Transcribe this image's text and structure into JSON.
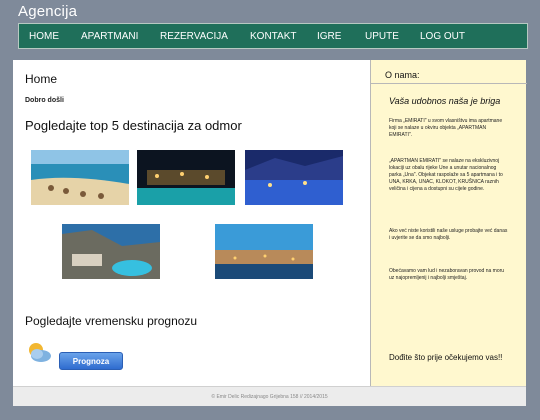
{
  "header": {
    "brand": "Agencija"
  },
  "nav": [
    {
      "label": "HOME"
    },
    {
      "label": "APARTMANI"
    },
    {
      "label": "REZERVACIJA"
    },
    {
      "label": "KONTAKT"
    },
    {
      "label": "IGRE"
    },
    {
      "label": "UPUTE"
    },
    {
      "label": "LOG OUT"
    }
  ],
  "main": {
    "title": "Home",
    "welcome": "Dobro došli",
    "destinations_title": "Pogledajte top 5 destinacija za odmor",
    "weather_title": "Pogledajte vremensku prognozu",
    "forecast_button": "Prognoza"
  },
  "sidebar": {
    "header": "O nama:",
    "slogan": "Vaša udobnos naša je briga",
    "paragraphs": [
      "Firma „EMIRATI\" u svom vlasništvu ima apartmane koji se nalaze u okviru objekta „APARTMAN EMIRATI\".",
      "„APARTMAN EMIRATI\" se nalaze na ekskluzivnoj lokaciji uz obalu rijeke Une a unutar nacionalnog parka „Una\". Objekat raspolaže sa 5 apartmana i to UNA, KRKA, UNAC, KLOKOT, KRUŠNICA raznih veličina i cijena a dostupni su cijele godine.",
      "Ako već niste koristili naše usluge probajte već danas i uvjerite se da smo najbolji.",
      "Obećavamo vam lud i nezaboravan provod na moru uz najopremljenij i najbolji smještaj."
    ],
    "closing": "Dođite što prije očekujemo vas!!"
  },
  "footer": {
    "text": "© Emir Delic Redizajnago Grijebna 158 // 2014/2015"
  }
}
